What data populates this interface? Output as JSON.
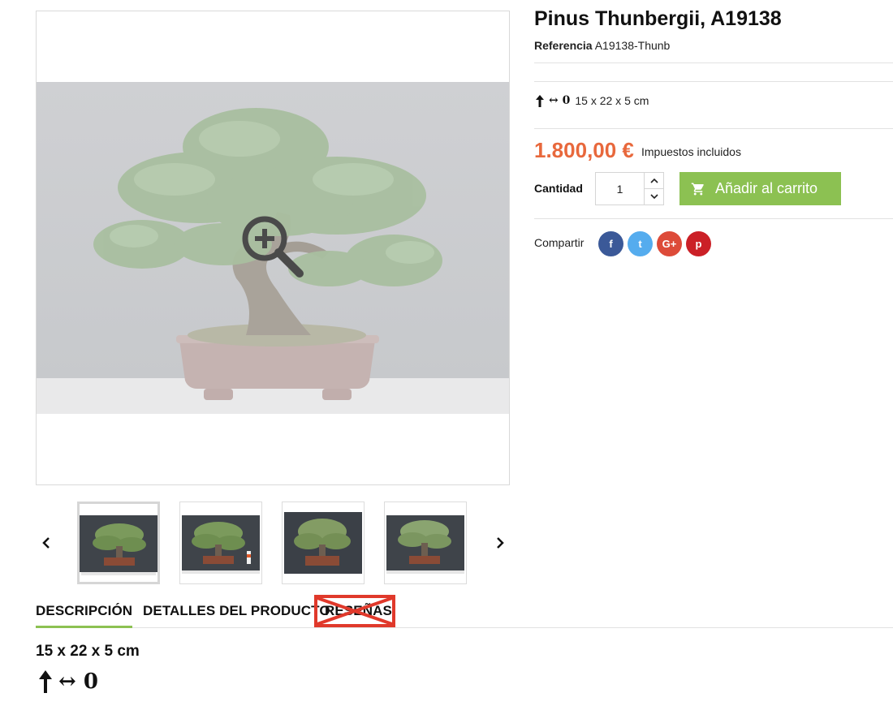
{
  "product": {
    "title": "Pinus Thunbergii, A19138",
    "reference_label": "Referencia",
    "reference_value": "A19138-Thunb",
    "dimensions": "15 x 22 x 5 cm",
    "price": "1.800,00 €",
    "tax_note": "Impuestos incluidos",
    "quantity_label": "Cantidad",
    "quantity_value": "1",
    "add_to_cart": "Añadir al carrito",
    "share_label": "Compartir",
    "symbols": "↔ 0"
  },
  "social": {
    "facebook": "f",
    "twitter": "t",
    "googleplus": "G+",
    "pinterest": "p"
  },
  "tabs": [
    {
      "label": "DESCRIPCIÓN",
      "active": true
    },
    {
      "label": "DETALLES DEL PRODUCTO",
      "active": false
    },
    {
      "label": "RESEÑAS",
      "active": false
    }
  ],
  "description": {
    "dimensions": "15 x 22 x 5 cm",
    "symbols": "↔ 0"
  },
  "icons": {
    "zoom": "zoom-in-icon",
    "prev": "chevron-left-icon",
    "next": "chevron-right-icon",
    "cart": "cart-icon",
    "up_arrow": "arrow-up-icon",
    "stepper_up": "chevron-up-icon",
    "stepper_down": "chevron-down-icon"
  },
  "colors": {
    "accent_green": "#8cc152",
    "price_orange": "#e8683c",
    "strike_red": "#e0392b",
    "facebook": "#3b5998",
    "twitter": "#55acee",
    "googleplus": "#dd4b39",
    "pinterest": "#cb2027"
  }
}
